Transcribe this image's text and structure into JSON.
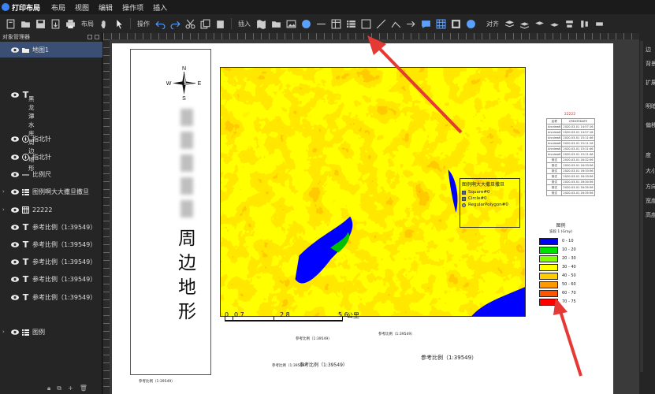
{
  "app": {
    "title": "打印布局"
  },
  "menu": [
    "布局",
    "视图",
    "编辑",
    "操作项",
    "插入"
  ],
  "toolbar": {
    "layout_label": "布局",
    "operate_label": "操作",
    "insert_label": "插入",
    "align_label": "对齐"
  },
  "left_panel": {
    "title": "对象管理器",
    "layers": [
      {
        "label": "地图1",
        "type": "map",
        "selected": true,
        "expandable": false
      },
      {
        "label": "",
        "type": "text",
        "selected": false,
        "expandable": false
      },
      {
        "label": "指北针",
        "type": "north",
        "selected": false,
        "expandable": false
      },
      {
        "label": "指北针",
        "type": "north",
        "selected": false,
        "expandable": false
      },
      {
        "label": "比例尺",
        "type": "scale",
        "selected": false,
        "expandable": false
      },
      {
        "label": "图例啊大大撒旦撒旦",
        "type": "legend",
        "selected": false,
        "expandable": true
      },
      {
        "label": "22222",
        "type": "table",
        "selected": false,
        "expandable": true
      },
      {
        "label": "参考比例（1:39549）",
        "type": "text",
        "selected": false,
        "expandable": false
      },
      {
        "label": "参考比例（1:39549）",
        "type": "text",
        "selected": false,
        "expandable": false
      },
      {
        "label": "参考比例（1:39549）",
        "type": "text",
        "selected": false,
        "expandable": false
      },
      {
        "label": "参考比例（1:39549）",
        "type": "text",
        "selected": false,
        "expandable": false
      },
      {
        "label": "参考比例（1:39549）",
        "type": "text",
        "selected": false,
        "expandable": false
      },
      {
        "label": "图例",
        "type": "legend",
        "selected": false,
        "expandable": true
      }
    ],
    "vertical_text_layer": "黑龙潭水库周边地形"
  },
  "page": {
    "compass": {
      "n": "N",
      "s": "S",
      "e": "E",
      "w": "W"
    },
    "vertical_title": "周边地形",
    "inner_legend": {
      "title": "图例啊大大撒旦撒旦",
      "items": [
        {
          "label": "Square#0",
          "color": "#2f6ea8"
        },
        {
          "label": "Circle#0",
          "color": "#3f8f3f"
        },
        {
          "label": "RegularPolygon#0",
          "color": "#7da6d4"
        }
      ]
    },
    "scalebar": {
      "labels": [
        "0",
        "0.7",
        "2.8",
        "5.6"
      ],
      "unit": "公里"
    },
    "table": {
      "title": "22222",
      "header": [
        "名称",
        "CREATEDATE"
      ],
      "rows": [
        [
          "Arcview6",
          "2020-03-01 14:57:16"
        ],
        [
          "Arcview6",
          "2020-03-01 14:57:16"
        ],
        [
          "Arcview6",
          "2020-03-01 15:11:46"
        ],
        [
          "Arcview6",
          "2020-03-01 15:11:16"
        ],
        [
          "Arcview6",
          "2020-03-01 15:11:46"
        ],
        [
          "Arcview6",
          "2020-03-01 15:11:46"
        ],
        [
          "测试",
          "2020-03-01 16:32:56"
        ],
        [
          "测试",
          "2020-03-01 16:33:56"
        ],
        [
          "测试",
          "2020-03-01 16:33:56"
        ],
        [
          "测试",
          "2020-03-01 16:33:56"
        ],
        [
          "测试",
          "2020-03-01 16:34:56"
        ],
        [
          "测试",
          "2020-03-01 16:35:56"
        ],
        [
          "测试",
          "2020-03-01 16:35:56"
        ]
      ]
    },
    "gray_legend": {
      "title": "图例",
      "subtitle": "波段 1 (Gray)",
      "items": [
        {
          "label": "0 - 10",
          "color": "#0000ff"
        },
        {
          "label": "10 - 20",
          "color": "#00e000"
        },
        {
          "label": "20 - 30",
          "color": "#7fff00"
        },
        {
          "label": "30 - 40",
          "color": "#ffff00"
        },
        {
          "label": "40 - 50",
          "color": "#ffcc00"
        },
        {
          "label": "50 - 60",
          "color": "#ff9900"
        },
        {
          "label": "60 - 70",
          "color": "#ff5500"
        },
        {
          "label": "70 - 75",
          "color": "#ff0000"
        }
      ]
    },
    "ref_labels": {
      "r1": "参考比例（1:39549）",
      "r2": "参考比例（1:39549）",
      "r3": "参考比例（1:39549）",
      "r4": "参考比例（1:39549）",
      "r5": "参考比例（1:39549）",
      "r6": "参考比例（1:39549）"
    }
  },
  "right_panel": {
    "items": [
      "边",
      "背景",
      "扩展",
      "明暗",
      "偏移",
      "度",
      "大小",
      "方向",
      "宽度",
      "高度"
    ]
  },
  "colors": {
    "annotation_arrow": "#e53935",
    "selection": "#3a4f73",
    "water": "#0000ff"
  }
}
